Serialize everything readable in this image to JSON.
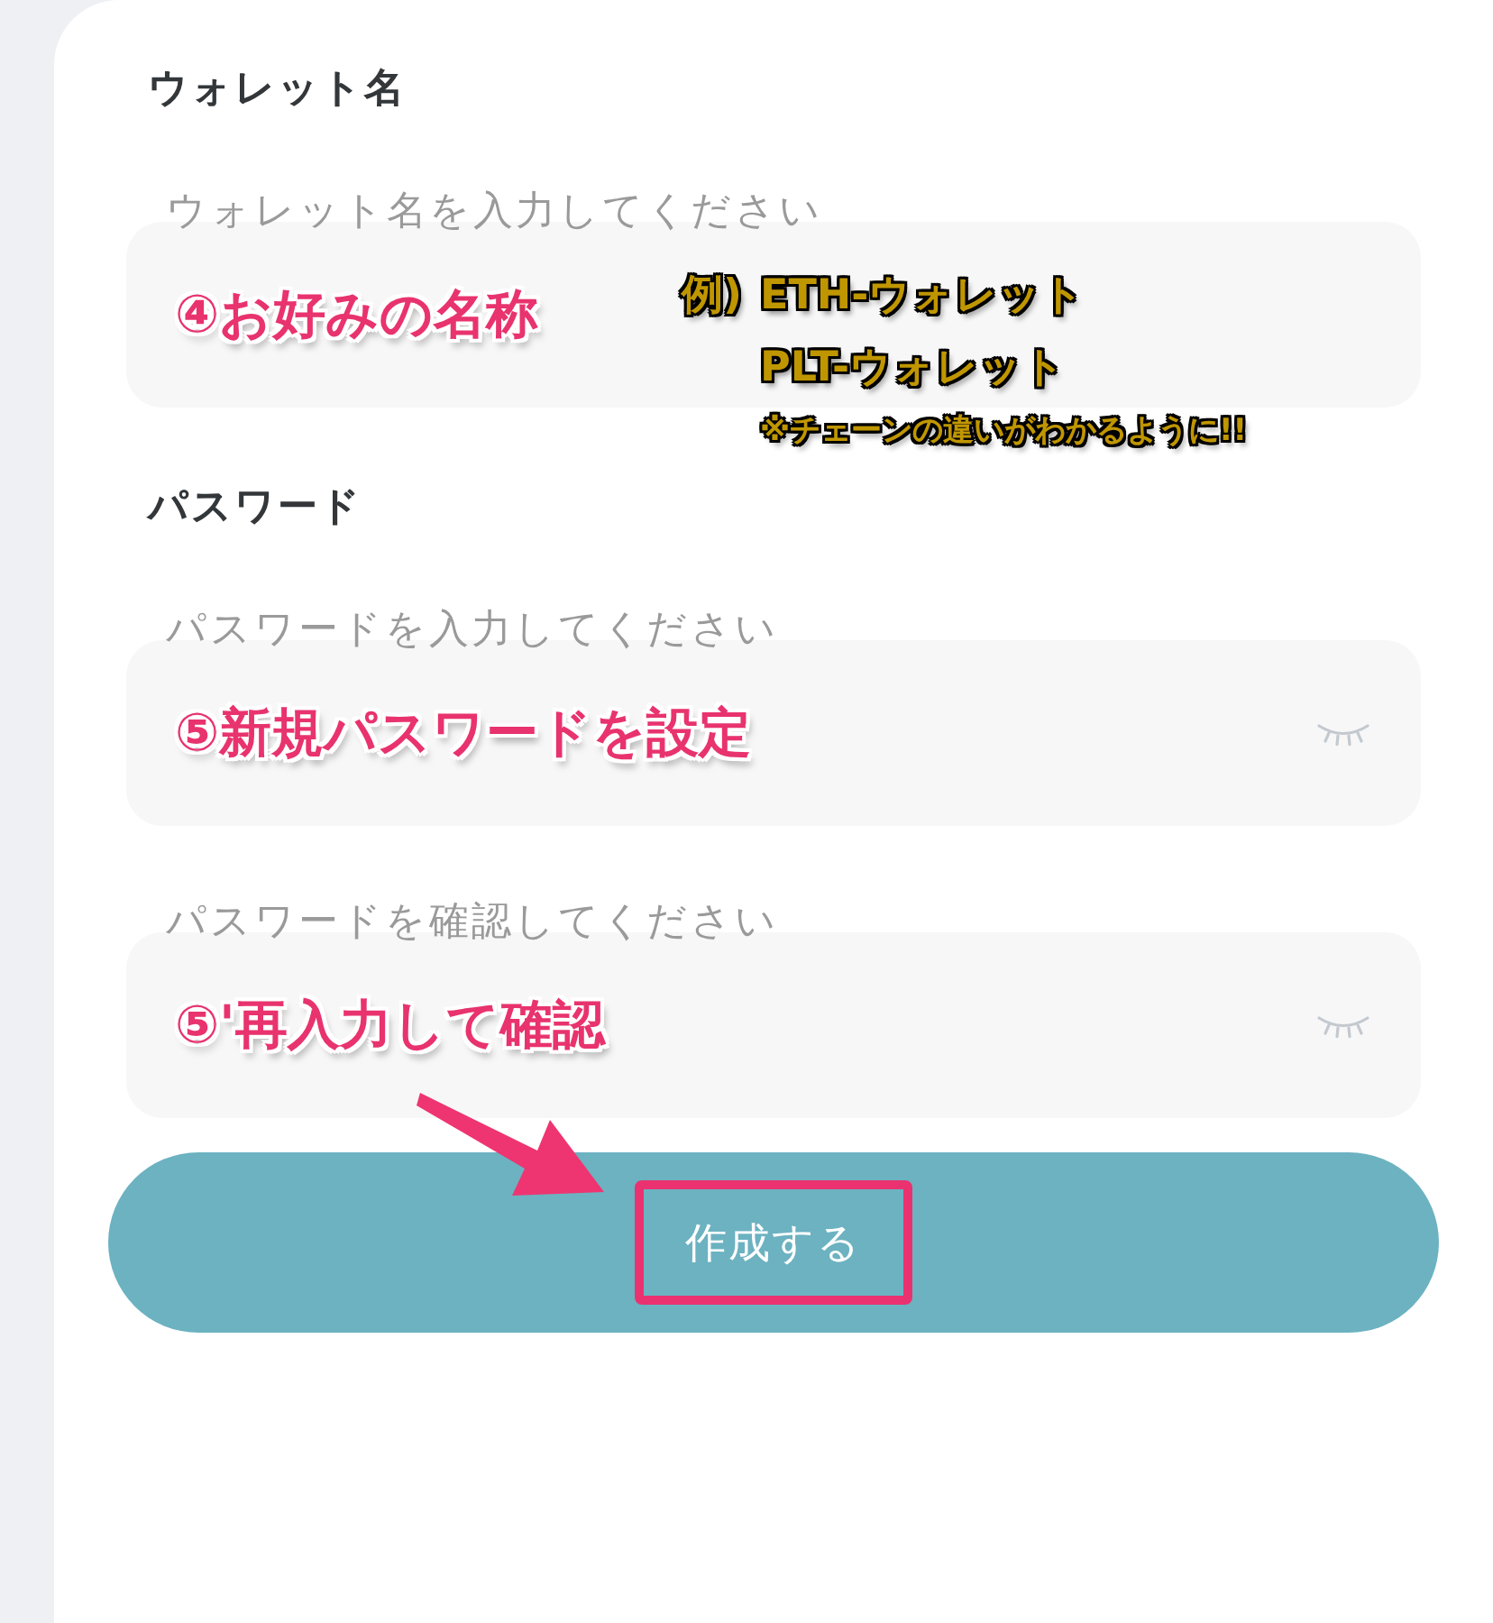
{
  "sections": [
    {
      "title": "ウォレット名",
      "fields": [
        {
          "kind": "text",
          "placeholder": "ウォレット名を入力してください",
          "annotation": "④お好みの名称",
          "note": {
            "prefix": "例)",
            "examples": [
              "ETH-ウォレット",
              "PLT-ウォレット"
            ],
            "remark": "※チェーンの違いがわかるように!!"
          }
        }
      ]
    },
    {
      "title": "パスワード",
      "fields": [
        {
          "kind": "password",
          "placeholder": "パスワードを入力してください",
          "annotation": "⑤新規パスワードを設定"
        },
        {
          "kind": "password",
          "placeholder": "パスワードを確認してください",
          "annotation": "⑤'再入力して確認"
        }
      ]
    }
  ],
  "submit": {
    "label": "作成する",
    "highlighted": true
  }
}
